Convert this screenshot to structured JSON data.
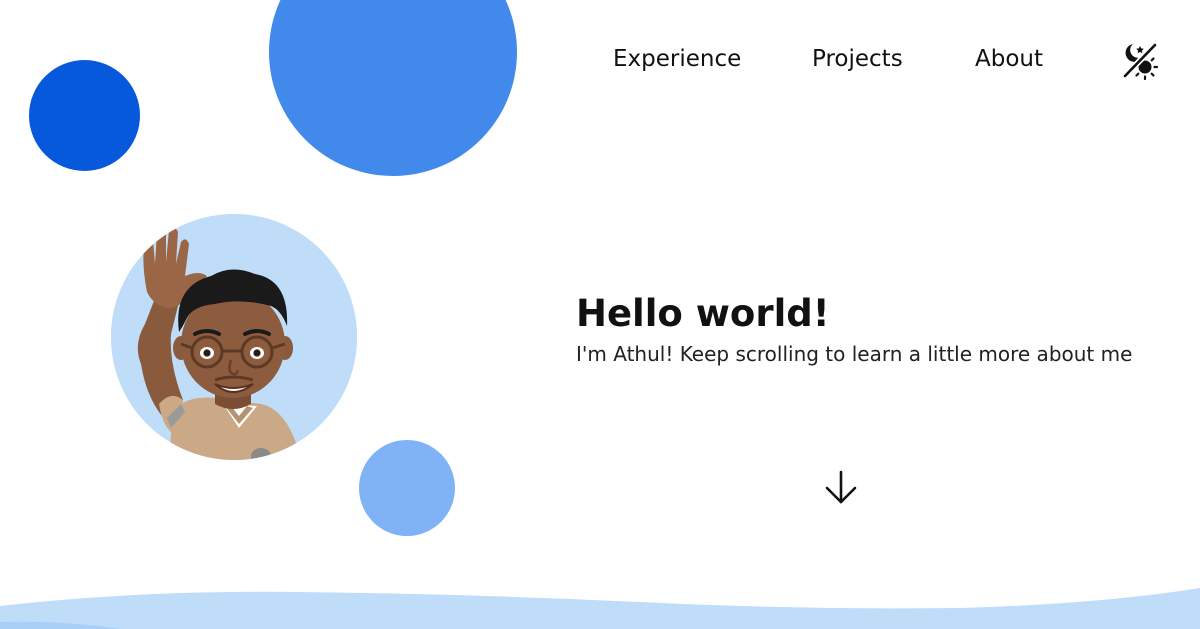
{
  "colors": {
    "blob_dark": "#0659db",
    "blob_mid": "#4289ec",
    "blob_light": "#7fb3f5",
    "avatar_bg": "#bfdcf9",
    "wave": "#bfdcf9",
    "text": "#111111"
  },
  "nav": {
    "items": [
      {
        "label": "Experience"
      },
      {
        "label": "Projects"
      },
      {
        "label": "About"
      }
    ],
    "theme_toggle_icon": "moon-sun-slash-icon"
  },
  "hero": {
    "title": "Hello world!",
    "subtitle": "I'm Athul! Keep scrolling to learn a little more about me",
    "avatar_icon": "memoji-avatar-waving",
    "scroll_icon": "arrow-down-icon"
  }
}
